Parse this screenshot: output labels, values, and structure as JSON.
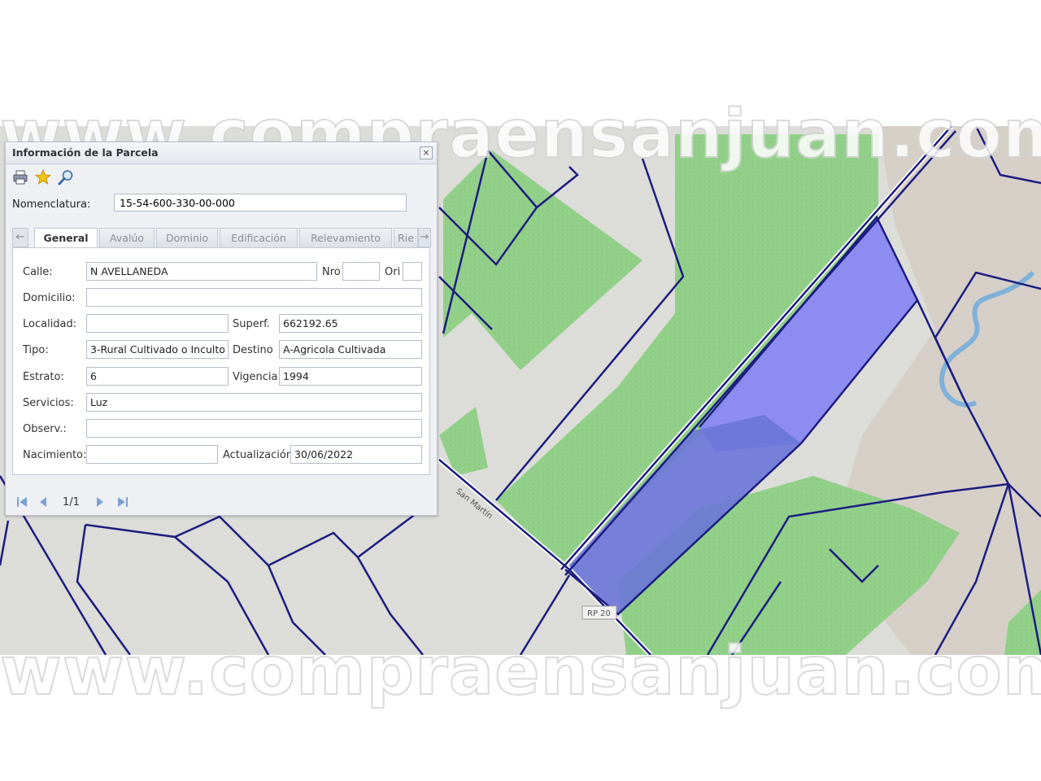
{
  "watermark": "www.compraensanjuan.com",
  "map": {
    "street_label": "San Martín",
    "road_badge": "RP 20",
    "colors": {
      "base": "#dcdcd8",
      "green": "#8fcf86",
      "parcel_line": "#1c1c80",
      "selection": "#8888f2",
      "river": "#7fb1d9"
    }
  },
  "panel": {
    "title": "Información de la Parcela",
    "close": "×",
    "nomenclatura_label": "Nomenclatura:",
    "nomenclatura_value": "15-54-600-330-00-000",
    "tabs": [
      "General",
      "Avalúo",
      "Dominio",
      "Edificación",
      "Relevamiento",
      "Rie"
    ],
    "active_tab": "General",
    "fields": {
      "calle_label": "Calle:",
      "calle": "N AVELLANEDA",
      "nro_label": "Nro",
      "nro": "",
      "ori_label": "Ori",
      "ori": "",
      "domicilio_label": "Domicilio:",
      "domicilio": "",
      "localidad_label": "Localidad:",
      "localidad": "",
      "superf_label": "Superf.",
      "superf": "662192.65",
      "tipo_label": "Tipo:",
      "tipo": "3-Rural Cultivado o Inculto",
      "destino_label": "Destino",
      "destino": "A-Agricola Cultivada",
      "estrato_label": "Estrato:",
      "estrato": "6",
      "vigencia_label": "Vigencia",
      "vigencia": "1994",
      "servicios_label": "Servicios:",
      "servicios": "Luz",
      "observ_label": "Observ.:",
      "observ": "",
      "nacimiento_label": "Nacimiento:",
      "nacimiento": "",
      "actualizacion_label": "Actualización",
      "actualizacion": "30/06/2022"
    },
    "pager": "1/1"
  }
}
